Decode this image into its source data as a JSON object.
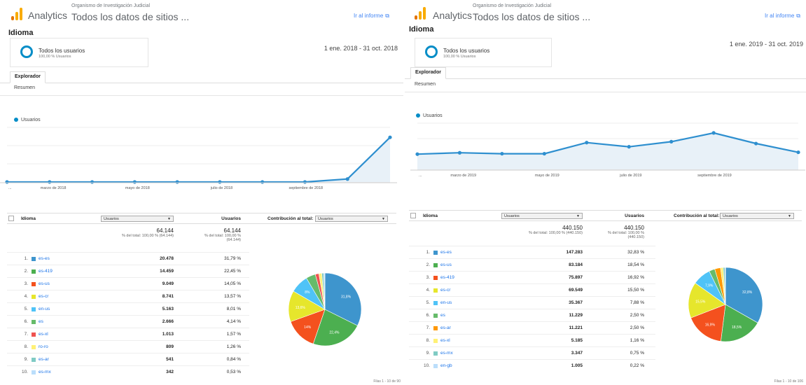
{
  "left": {
    "app_name": "Analytics",
    "org": "Organismo de Investigación Judicial",
    "view": "Todos los datos de sitios ...",
    "report_link": "Ir al informe",
    "title": "Idioma",
    "segment_name": "Todos los usuarios",
    "segment_pct": "100,00 % Usuarios",
    "date_range": "1 ene. 2018 - 31 oct. 2018",
    "tab": "Explorador",
    "subtab": "Resumen",
    "table": {
      "dim_header": "Idioma",
      "metric_select": "Usuarios",
      "metric_header": "Usuarios",
      "contrib_label": "Contribución al total:",
      "contrib_select": "Usuarios",
      "total1": "64.144",
      "total1_sub": "% del total: 100,00 % (64.144)",
      "total2": "64.144",
      "total2_sub": "% del total: 100,00 % (64.144)"
    },
    "footer": "Filas 1 - 10 de 90",
    "chart_data": [
      {
        "type": "line",
        "series": [
          {
            "name": "Usuarios",
            "values": [
              0,
              0,
              0,
              0,
              0,
              0,
              0,
              0,
              1200,
              18000
            ]
          }
        ],
        "x_labels": [
          "...",
          "marzo de 2018",
          "mayo de 2018",
          "julio de 2018",
          "septiembre de 2018"
        ],
        "ylim": [
          0,
          22000
        ],
        "grid": true,
        "legend": "top-left"
      },
      {
        "type": "pie",
        "labels": [
          "es-es",
          "es-419",
          "es-us",
          "es-cr",
          "en-us",
          "es",
          "es-xl",
          "ro-ro",
          "es-ar",
          "es-mx"
        ],
        "values": [
          20478,
          14459,
          9049,
          8741,
          5163,
          2666,
          1013,
          809,
          541,
          342
        ],
        "percents": [
          "31,79 %",
          "22,45 %",
          "14,05 %",
          "13,57 %",
          "8,01 %",
          "4,14 %",
          "1,57 %",
          "1,26 %",
          "0,84 %",
          "0,53 %"
        ],
        "colors": [
          "#3e95cd",
          "#4caf50",
          "#f4511e",
          "#e6e62c",
          "#4fc3f7",
          "#66bb6a",
          "#ef5350",
          "#fff176",
          "#80cbc4",
          "#bbdefb"
        ],
        "slice_labels": [
          "31,8%",
          "22,4%",
          "14%",
          "13,6%",
          "8%"
        ]
      }
    ]
  },
  "right": {
    "app_name": "Analytics",
    "org": "Organismo de Investigación Judicial",
    "view": "Todos los datos de sitios ...",
    "report_link": "Ir al informe",
    "title": "Idioma",
    "segment_name": "Todos los usuarios",
    "segment_pct": "100,00 % Usuarios",
    "date_range": "1 ene. 2019 - 31 oct. 2019",
    "tab": "Explorador",
    "subtab": "Resumen",
    "table": {
      "dim_header": "Idioma",
      "metric_select": "Usuarios",
      "metric_header": "Usuarios",
      "contrib_label": "Contribución al total:",
      "contrib_select": "Usuarios",
      "total1": "440.150",
      "total1_sub": "% del total: 100,00 % (440.150)",
      "total2": "440.150",
      "total2_sub": "% del total: 100,00 % (440.150)"
    },
    "footer": "Filas 1 - 10 de 106",
    "chart_data": [
      {
        "type": "line",
        "series": [
          {
            "name": "Usuarios",
            "values": [
              33000,
              36000,
              34000,
              34000,
              58000,
              49000,
              60000,
              79000,
              56000,
              37000
            ]
          }
        ],
        "x_labels": [
          "...",
          "marzo de 2019",
          "mayo de 2019",
          "julio de 2019",
          "septiembre de 2019"
        ],
        "ylim": [
          0,
          100000
        ],
        "grid": true,
        "legend": "top-left"
      },
      {
        "type": "pie",
        "labels": [
          "es-es",
          "es-us",
          "es-419",
          "es-cr",
          "en-us",
          "es",
          "es-ar",
          "es-xl",
          "es-mx",
          "en-gb"
        ],
        "values": [
          147283,
          83184,
          75897,
          69549,
          35367,
          11229,
          11221,
          5185,
          3347,
          1005
        ],
        "percents": [
          "32,83 %",
          "18,54 %",
          "16,92 %",
          "15,50 %",
          "7,88 %",
          "2,50 %",
          "2,50 %",
          "1,16 %",
          "0,75 %",
          "0,22 %"
        ],
        "colors": [
          "#3e95cd",
          "#4caf50",
          "#f4511e",
          "#e6e62c",
          "#4fc3f7",
          "#66bb6a",
          "#ff9800",
          "#fff176",
          "#80cbc4",
          "#bbdefb"
        ],
        "slice_labels": [
          "32,8%",
          "18,5%",
          "16,9%",
          "15,5%",
          "7,9%"
        ]
      }
    ]
  }
}
